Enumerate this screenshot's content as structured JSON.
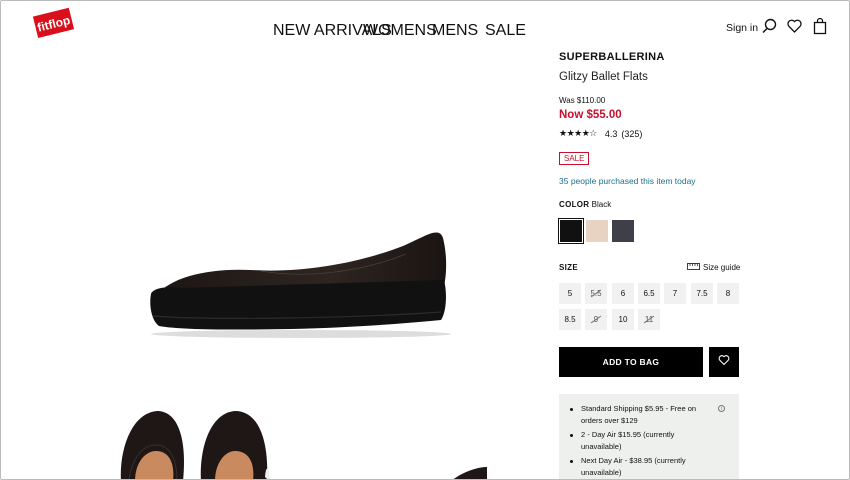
{
  "header": {
    "logo_text": "fitflop",
    "nav": [
      "NEW ARRIVALS",
      "WOMENS",
      "MENS",
      "SALE"
    ],
    "sign_in": "Sign in",
    "icons": [
      "search-icon",
      "heart-icon",
      "bag-icon"
    ]
  },
  "product": {
    "brand": "SUPERBALLERINA",
    "name": "Glitzy Ballet Flats",
    "was_price": "Was $110.00",
    "now_price": "Now $55.00",
    "rating_value": "4.3",
    "rating_count": "(325)",
    "rating_stars": "★★★★☆",
    "badge": "SALE",
    "social_proof": "35 people purchased this item today",
    "color_label": "COLOR",
    "color_value": "Black",
    "swatches": [
      "#111111",
      "#e8d3c3",
      "#3f3f4a"
    ],
    "size_label": "SIZE",
    "size_guide": "Size guide",
    "sizes": [
      {
        "label": "5",
        "available": true
      },
      {
        "label": "5.5",
        "available": false
      },
      {
        "label": "6",
        "available": true
      },
      {
        "label": "6.5",
        "available": true
      },
      {
        "label": "7",
        "available": true
      },
      {
        "label": "7.5",
        "available": true
      },
      {
        "label": "8",
        "available": true
      },
      {
        "label": "8.5",
        "available": true
      },
      {
        "label": "9",
        "available": false
      },
      {
        "label": "10",
        "available": true
      },
      {
        "label": "11",
        "available": false
      }
    ],
    "add_to_bag": "ADD TO BAG",
    "shipping": [
      "Standard Shipping $5.95 - Free on orders over $129",
      "2 - Day Air $15.95 (currently unavailable)",
      "Next Day Air - $38.95 (currently unavailable)"
    ],
    "accent_color": "#c8102e"
  }
}
